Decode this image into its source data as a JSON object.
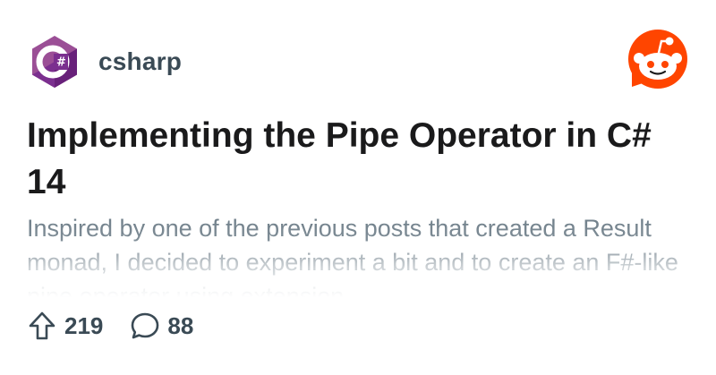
{
  "subreddit": {
    "name": "csharp",
    "icon": "csharp-logo-icon",
    "accent": "#68217a"
  },
  "brand": {
    "icon": "reddit-logo-icon",
    "color": "#ff4500"
  },
  "post": {
    "title": "Implementing the Pipe Operator in C# 14",
    "body": "Inspired by one of the previous posts that created a Result monad, I decided to experiment a bit and to create an F#-like pipe operator using extension"
  },
  "stats": {
    "upvotes": "219",
    "upvote_icon": "upvote-arrow-icon",
    "comments": "88",
    "comment_icon": "comment-bubble-icon"
  }
}
